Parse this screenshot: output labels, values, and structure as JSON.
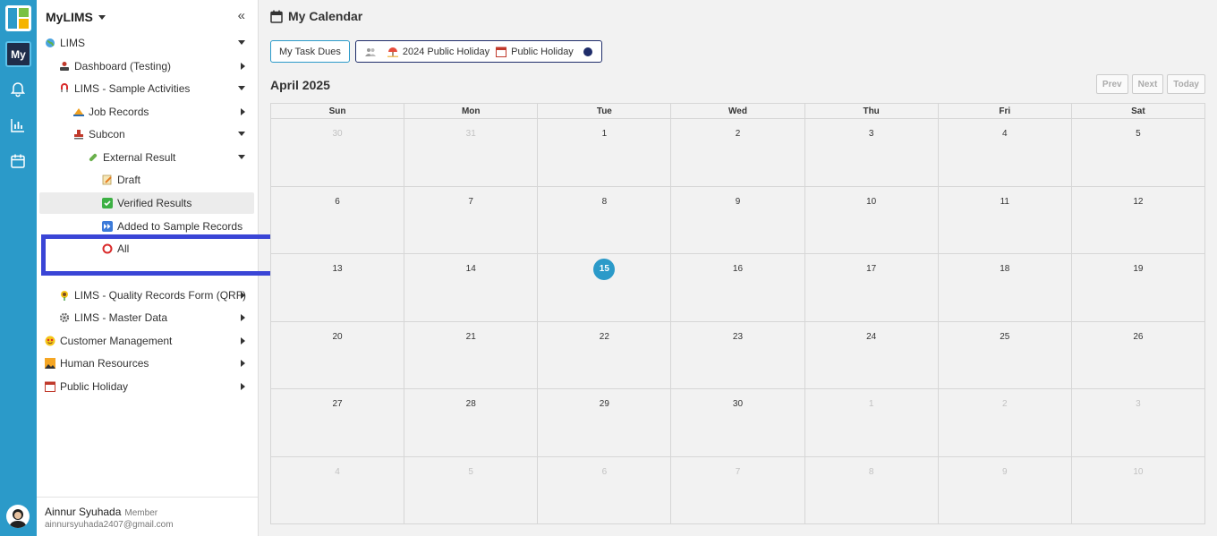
{
  "rail": {
    "my_label": "My"
  },
  "sidebar": {
    "app_title": "MyLIMS",
    "items": [
      {
        "label": "LIMS",
        "icon": "globe-icon"
      },
      {
        "label": "Dashboard (Testing)",
        "icon": "person-icon"
      },
      {
        "label": "LIMS - Sample Activities",
        "icon": "magnet-icon"
      },
      {
        "label": "Job Records",
        "icon": "hat-icon"
      },
      {
        "label": "Subcon",
        "icon": "stamp-icon"
      },
      {
        "label": "External Result",
        "icon": "pill-icon"
      },
      {
        "label": "Draft",
        "icon": "memo-icon"
      },
      {
        "label": "Verified Results",
        "icon": "check-icon"
      },
      {
        "label": "Added to Sample Records",
        "icon": "fast-forward-icon"
      },
      {
        "label": "All",
        "icon": "circle-icon"
      },
      {
        "label": "LIMS - Quality Records Form (QRF)",
        "icon": "sunflower-icon"
      },
      {
        "label": "LIMS - Master Data",
        "icon": "gear-icon"
      },
      {
        "label": "Customer Management",
        "icon": "star-face-icon"
      },
      {
        "label": "Human Resources",
        "icon": "picture-icon"
      },
      {
        "label": "Public Holiday",
        "icon": "calendar-icon"
      }
    ],
    "user": {
      "name": "Ainnur Syuhada",
      "role": "Member",
      "email": "ainnursyuhada2407@gmail.com"
    }
  },
  "main": {
    "title": "My Calendar",
    "filters": {
      "task_button": "My Task Dues",
      "holiday_2024": "2024 Public Holiday",
      "holiday": "Public Holiday"
    },
    "month_label": "April 2025",
    "nav": {
      "prev": "Prev",
      "next": "Next",
      "today": "Today"
    },
    "weekdays": [
      "Sun",
      "Mon",
      "Tue",
      "Wed",
      "Thu",
      "Fri",
      "Sat"
    ],
    "weeks": [
      [
        "30",
        "31",
        "1",
        "2",
        "3",
        "4",
        "5"
      ],
      [
        "6",
        "7",
        "8",
        "9",
        "10",
        "11",
        "12"
      ],
      [
        "13",
        "14",
        "15",
        "16",
        "17",
        "18",
        "19"
      ],
      [
        "20",
        "21",
        "22",
        "23",
        "24",
        "25",
        "26"
      ],
      [
        "27",
        "28",
        "29",
        "30",
        "1",
        "2",
        "3"
      ],
      [
        "4",
        "5",
        "6",
        "7",
        "8",
        "9",
        "10"
      ]
    ],
    "today": "15"
  },
  "colors": {
    "accent": "#2b9ac9",
    "highlight_box": "#3a45d6",
    "holiday_dot": "#1f2d6a"
  }
}
